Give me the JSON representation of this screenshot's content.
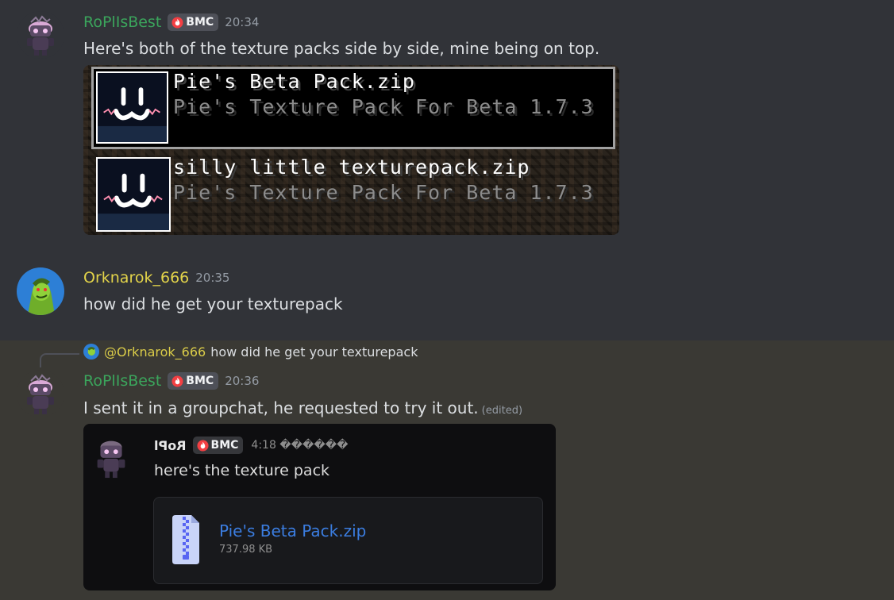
{
  "messages": [
    {
      "author": "RoPlIsBest",
      "author_color": "#3ba55c",
      "badge": "BMC",
      "timestamp": "20:34",
      "text": "Here's both of the texture packs side by side, mine being on top.",
      "attachment": {
        "packs": [
          {
            "title": "Pie's Beta Pack.zip",
            "description": "Pie's Texture Pack For Beta 1.7.3"
          },
          {
            "title": "silly little texturepack.zip",
            "description": "Pie's Texture Pack For Beta 1.7.3"
          }
        ]
      }
    },
    {
      "author": "Orknarok_666",
      "author_color": "#e3d44a",
      "timestamp": "20:35",
      "text": "how did he get your texturepack"
    },
    {
      "author": "RoPlIsBest",
      "author_color": "#3ba55c",
      "badge": "BMC",
      "timestamp": "20:36",
      "text": "I sent it in a groupchat, he requested to try it out.",
      "edited": "(edited)",
      "reply": {
        "mention": "@Orknarok_666",
        "text": "how did he get your texturepack"
      },
      "embed": {
        "author": "RoPl",
        "badge": "BMC",
        "timestamp": "4:18 ������",
        "text": "here's the texture pack",
        "file": {
          "name": "Pie's Beta Pack.zip",
          "size": "737.98 KB"
        }
      }
    }
  ],
  "icons": [
    "avatar-robot",
    "avatar-grinch",
    "flame-badge-icon",
    "zip-file-icon"
  ]
}
